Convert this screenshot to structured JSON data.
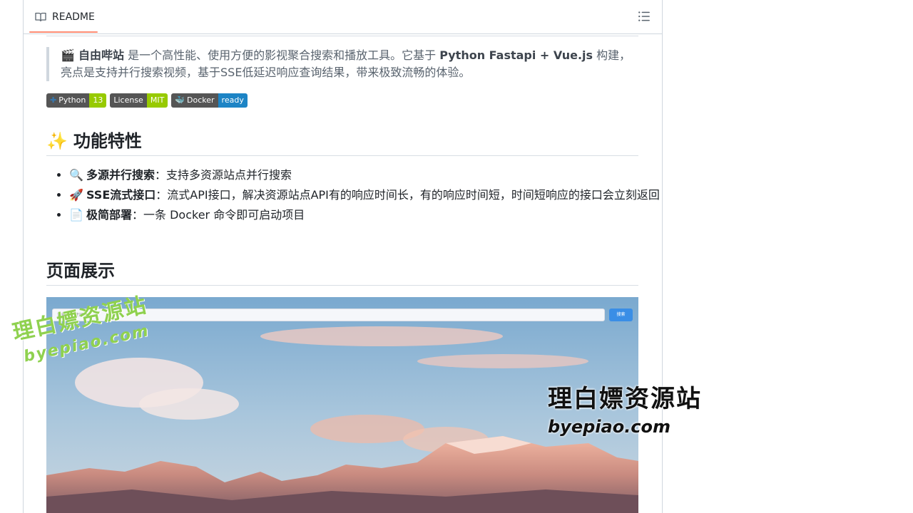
{
  "tab": {
    "label": "README"
  },
  "intro": {
    "emoji": "🎬",
    "name": "自由哔站",
    "text1": " 是一个高性能、使用方便的影视聚合搜索和播放工具。它基于 ",
    "stack": "Python Fastapi + Vue.js",
    "text2": " 构建，亮点是支持并行搜索视频，基于SSE低延迟响应查询结果，带来极致流畅的体验。"
  },
  "badges": [
    {
      "left": "Python",
      "right": "13",
      "color": "#97ca00"
    },
    {
      "left": "License",
      "right": "MIT",
      "color": "#97ca00"
    },
    {
      "left": "Docker",
      "right": "ready",
      "color": "#1d84c5"
    }
  ],
  "features": {
    "heading": "功能特性",
    "heading_emoji": "✨",
    "items": [
      {
        "icon": "🔍",
        "title": "多源并行搜索",
        "desc": "：支持多资源站点并行搜索"
      },
      {
        "icon": "🚀",
        "title": "SSE流式接口",
        "desc": "：流式API接口，解决资源站点API有的响应时间长，有的响应时间短，时间短响应的接口会立刻返回"
      },
      {
        "icon": "📄",
        "title": "极简部署",
        "desc": "：一条 Docker 命令即可启动项目"
      }
    ]
  },
  "showcase": {
    "heading": "页面展示",
    "search_placeholder": "请输入关键词...",
    "search_button": "搜索"
  },
  "watermarks": {
    "title": "理白嫖资源站",
    "domain": "byepiao.com"
  }
}
